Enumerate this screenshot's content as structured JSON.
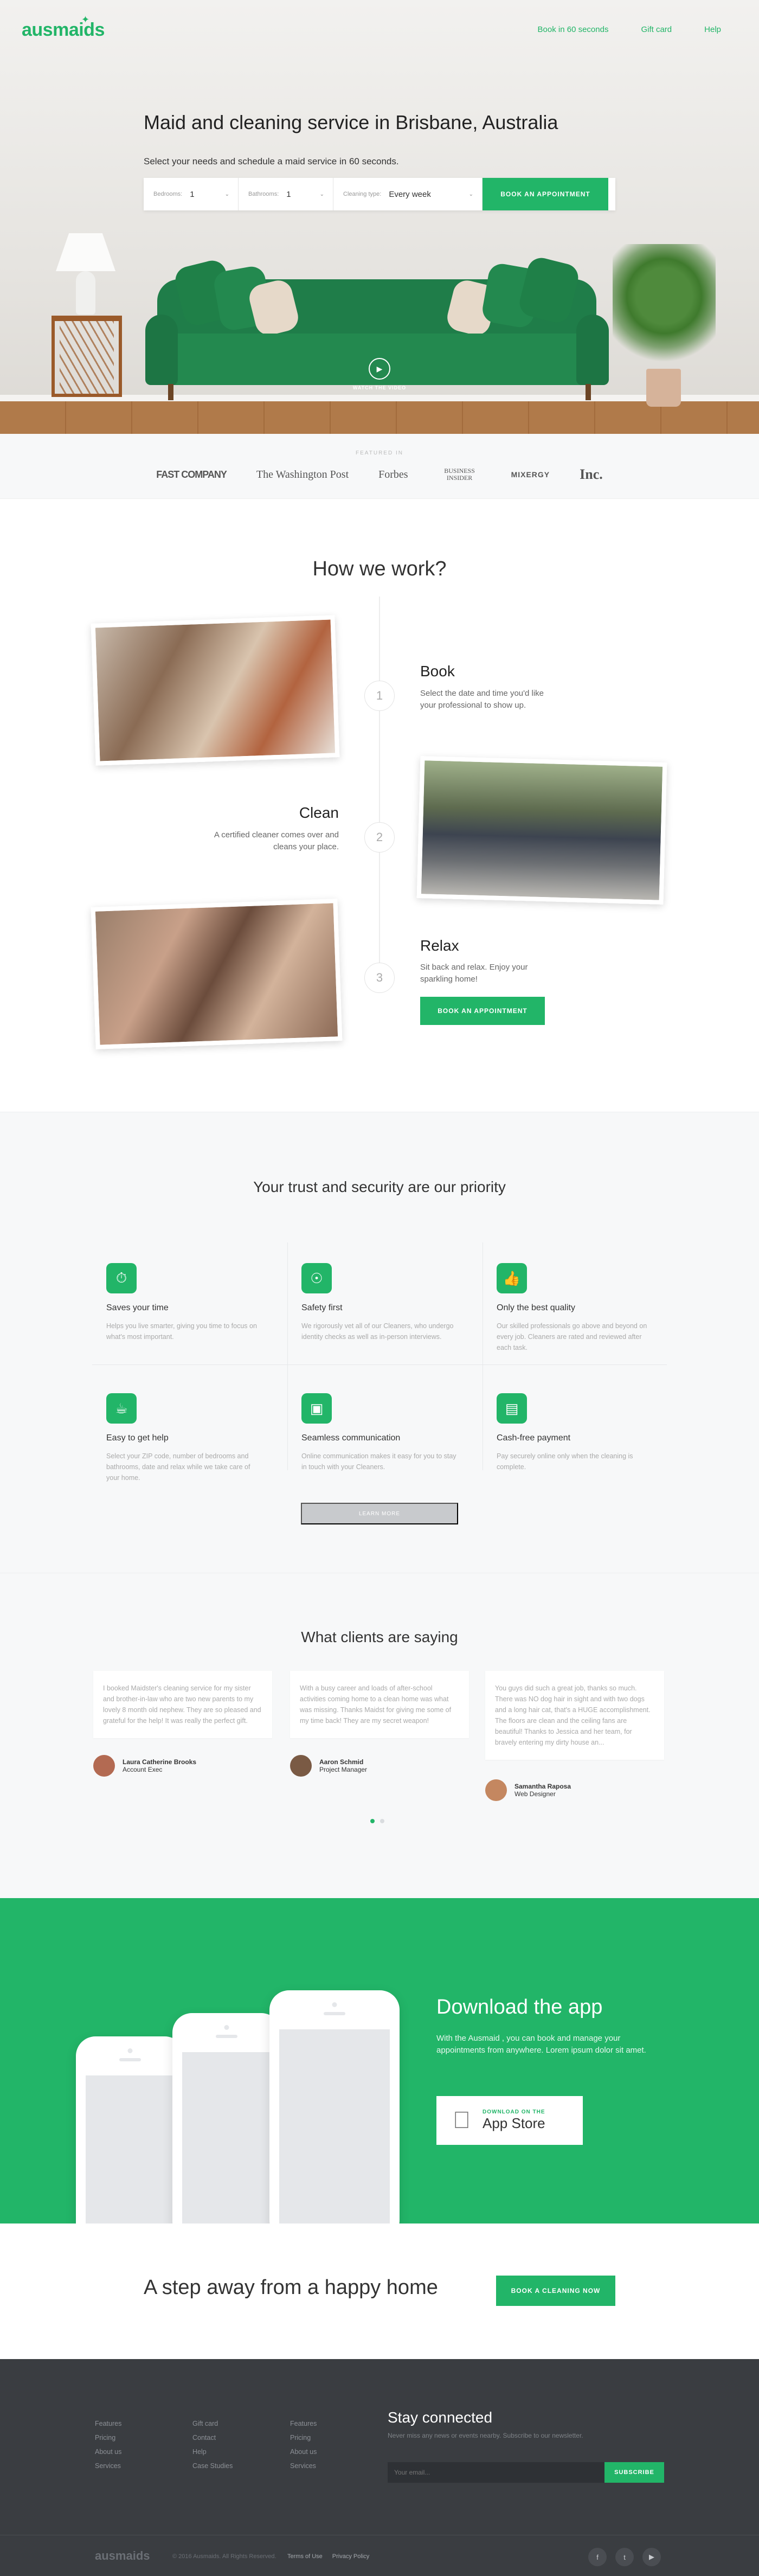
{
  "nav": {
    "logo": "ausmaids",
    "links": [
      "Book in 60 seconds",
      "Gift card",
      "Help"
    ]
  },
  "hero": {
    "title": "Maid and cleaning service in Brisbane, Australia",
    "subtitle": "Select your needs and schedule a maid service in 60 seconds.",
    "bedrooms_label": "Bedrooms:",
    "bedrooms_value": "1",
    "bathrooms_label": "Bathrooms:",
    "bathrooms_value": "1",
    "cleaning_label": "Cleaning type:",
    "cleaning_value": "Every week",
    "book_button": "BOOK AN APPOINTMENT",
    "watch_video": "WATCH THE VIDEO"
  },
  "featured": {
    "label": "FEATURED IN",
    "logos": [
      "FAST COMPANY",
      "The Washington Post",
      "Forbes",
      "BUSINESS INSIDER",
      "MIXERGY",
      "Inc."
    ]
  },
  "how": {
    "title": "How we work?",
    "steps": [
      {
        "num": "1",
        "title": "Book",
        "text": "Select the date and time you'd like your professional to show up."
      },
      {
        "num": "2",
        "title": "Clean",
        "text": "A certified cleaner comes over and cleans your place."
      },
      {
        "num": "3",
        "title": "Relax",
        "text": "Sit back and relax. Enjoy your sparkling home!"
      }
    ],
    "cta": "BOOK AN APPOINTMENT"
  },
  "trust": {
    "title": "Your trust and security are our priority",
    "features": [
      {
        "icon": "stopwatch-icon",
        "title": "Saves your time",
        "text": "Helps you live smarter, giving you time to focus on what's most important."
      },
      {
        "icon": "lock-icon",
        "title": "Safety first",
        "text": "We rigorously vet all of our Cleaners, who undergo identity checks as well as in-person interviews."
      },
      {
        "icon": "thumbs-up-icon",
        "title": "Only the best quality",
        "text": "Our skilled professionals go above and beyond on every job. Cleaners are rated and reviewed after each task."
      },
      {
        "icon": "bowl-icon",
        "title": "Easy to get help",
        "text": "Select your ZIP code, number of bedrooms and bathrooms, date and relax while we take care of your home."
      },
      {
        "icon": "monitor-icon",
        "title": "Seamless communication",
        "text": "Online communication makes it easy for you to stay in touch with your Cleaners."
      },
      {
        "icon": "wallet-icon",
        "title": "Cash-free payment",
        "text": "Pay securely online only when the cleaning is complete."
      }
    ],
    "learn_more": "LEARN MORE"
  },
  "testimonials": {
    "title": "What clients are saying",
    "items": [
      {
        "text": "I booked Maidster's cleaning service for my sister and brother-in-law who are two new parents to my lovely 8 month old nephew. They are so pleased and grateful for the help! It was really the perfect gift.",
        "name": "Laura Catherine Brooks",
        "role": "Account Exec"
      },
      {
        "text": "With a busy career and loads of after-school activities coming home to a clean home was what was missing. Thanks Maidst for giving me some of my time back! They are my secret weapon!",
        "name": "Aaron Schmid",
        "role": "Project Manager"
      },
      {
        "text": "You guys did such a great job, thanks so much. There was NO dog hair in sight and with two dogs and a long hair cat, that's a HUGE accomplishment. The floors are clean and the ceiling fans are beautiful! Thanks to Jessica and her team, for bravely entering my dirty house an...",
        "name": "Samantha Raposa",
        "role": "Web Designer"
      }
    ]
  },
  "download": {
    "title": "Download the app",
    "text": "With the Ausmaid , you can book and manage your appointments from anywhere. Lorem ipsum dolor sit amet.",
    "store_small": "DOWNLOAD ON THE",
    "store_big": "App Store"
  },
  "away": {
    "title": "A step away from a happy home",
    "button": "BOOK A CLEANING NOW"
  },
  "footer": {
    "col1": [
      "Features",
      "Pricing",
      "About us",
      "Services"
    ],
    "col2": [
      "Gift card",
      "Contact",
      "Help",
      "Case Studies"
    ],
    "col3": [
      "Features",
      "Pricing",
      "About us",
      "Services"
    ],
    "stay_title": "Stay connected",
    "stay_sub": "Never miss any news or events nearby. Subscribe to our newsletter.",
    "email_placeholder": "Your email...",
    "subscribe": "SUBSCRIBE",
    "logo": "ausmaids",
    "copyright": "© 2016 Ausmaids. All Rights Reserved.",
    "links": [
      "Terms of Use",
      "Privacy Policy"
    ],
    "social": [
      "f",
      "t",
      "▶"
    ]
  },
  "colors": {
    "brand": "#22b568",
    "footer": "#3a3d41"
  }
}
